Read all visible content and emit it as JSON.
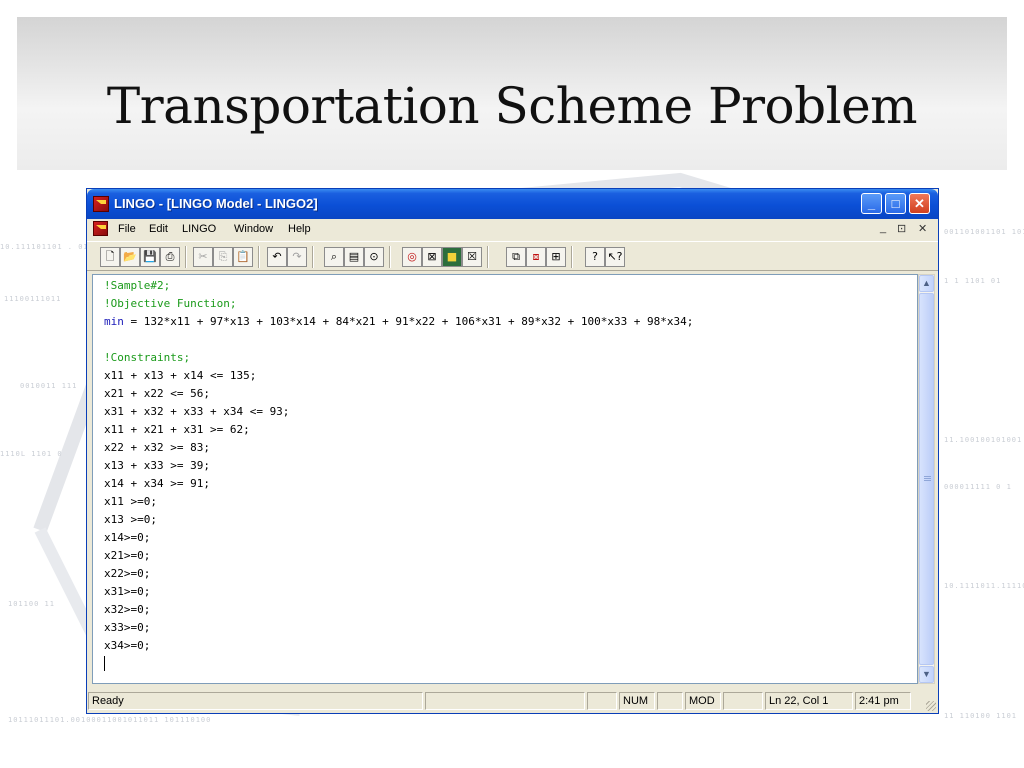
{
  "slide": {
    "title": "Transportation Scheme Problem"
  },
  "window": {
    "title": "LINGO - [LINGO Model - LINGO2]",
    "controls": {
      "minimize": "_",
      "maximize": "□",
      "close": "✕"
    }
  },
  "menu": {
    "items": [
      "File",
      "Edit",
      "LINGO",
      "Window",
      "Help"
    ],
    "mdi_controls": [
      "_",
      "⊡",
      "✕"
    ]
  },
  "toolbar": {
    "groups": [
      [
        "new-icon",
        "open-icon",
        "save-icon",
        "print-icon"
      ],
      [
        "cut-icon",
        "copy-icon",
        "paste-icon"
      ],
      [
        "undo-icon",
        "redo-icon"
      ],
      [
        "find-icon",
        "goto-line-icon",
        "match-parenthesis-icon"
      ],
      [
        "solve-icon",
        "solution-icon",
        "matrix-picture-icon",
        "close-all-icon"
      ],
      [
        "tile-icon",
        "send-to-back-icon",
        "cascade-icon"
      ],
      [
        "help-icon",
        "context-help-icon"
      ]
    ]
  },
  "editor": {
    "lines": [
      {
        "type": "comment",
        "text": "!Sample#2;"
      },
      {
        "type": "comment",
        "text": "!Objective Function;"
      },
      {
        "type": "objective",
        "keyword": "min",
        "text": " = 132*x11 + 97*x13 + 103*x14 + 84*x21 + 91*x22 + 106*x31 + 89*x32 + 100*x33 + 98*x34;"
      },
      {
        "type": "blank",
        "text": ""
      },
      {
        "type": "comment",
        "text": "!Constraints;"
      },
      {
        "type": "code",
        "text": "x11 + x13 + x14 <= 135;"
      },
      {
        "type": "code",
        "text": "x21 + x22 <= 56;"
      },
      {
        "type": "code",
        "text": "x31 + x32 + x33 + x34 <= 93;"
      },
      {
        "type": "code",
        "text": "x11 + x21 + x31 >= 62;"
      },
      {
        "type": "code",
        "text": "x22 + x32 >= 83;"
      },
      {
        "type": "code",
        "text": "x13 + x33 >= 39;"
      },
      {
        "type": "code",
        "text": "x14 + x34 >= 91;"
      },
      {
        "type": "code",
        "text": "x11 >=0;"
      },
      {
        "type": "code",
        "text": "x13 >=0;"
      },
      {
        "type": "code",
        "text": "x14>=0;"
      },
      {
        "type": "code",
        "text": "x21>=0;"
      },
      {
        "type": "code",
        "text": "x22>=0;"
      },
      {
        "type": "code",
        "text": "x31>=0;"
      },
      {
        "type": "code",
        "text": "x32>=0;"
      },
      {
        "type": "code",
        "text": "x33>=0;"
      },
      {
        "type": "code",
        "text": "x34>=0;"
      }
    ]
  },
  "status": {
    "message": "Ready",
    "num": "NUM",
    "mod": "MOD",
    "position": "Ln 22, Col 1",
    "time": "2:41 pm"
  },
  "colors": {
    "comment": "#1a9a1a",
    "keyword": "#1a1ab8",
    "titlebar": "#0b4fd6"
  }
}
